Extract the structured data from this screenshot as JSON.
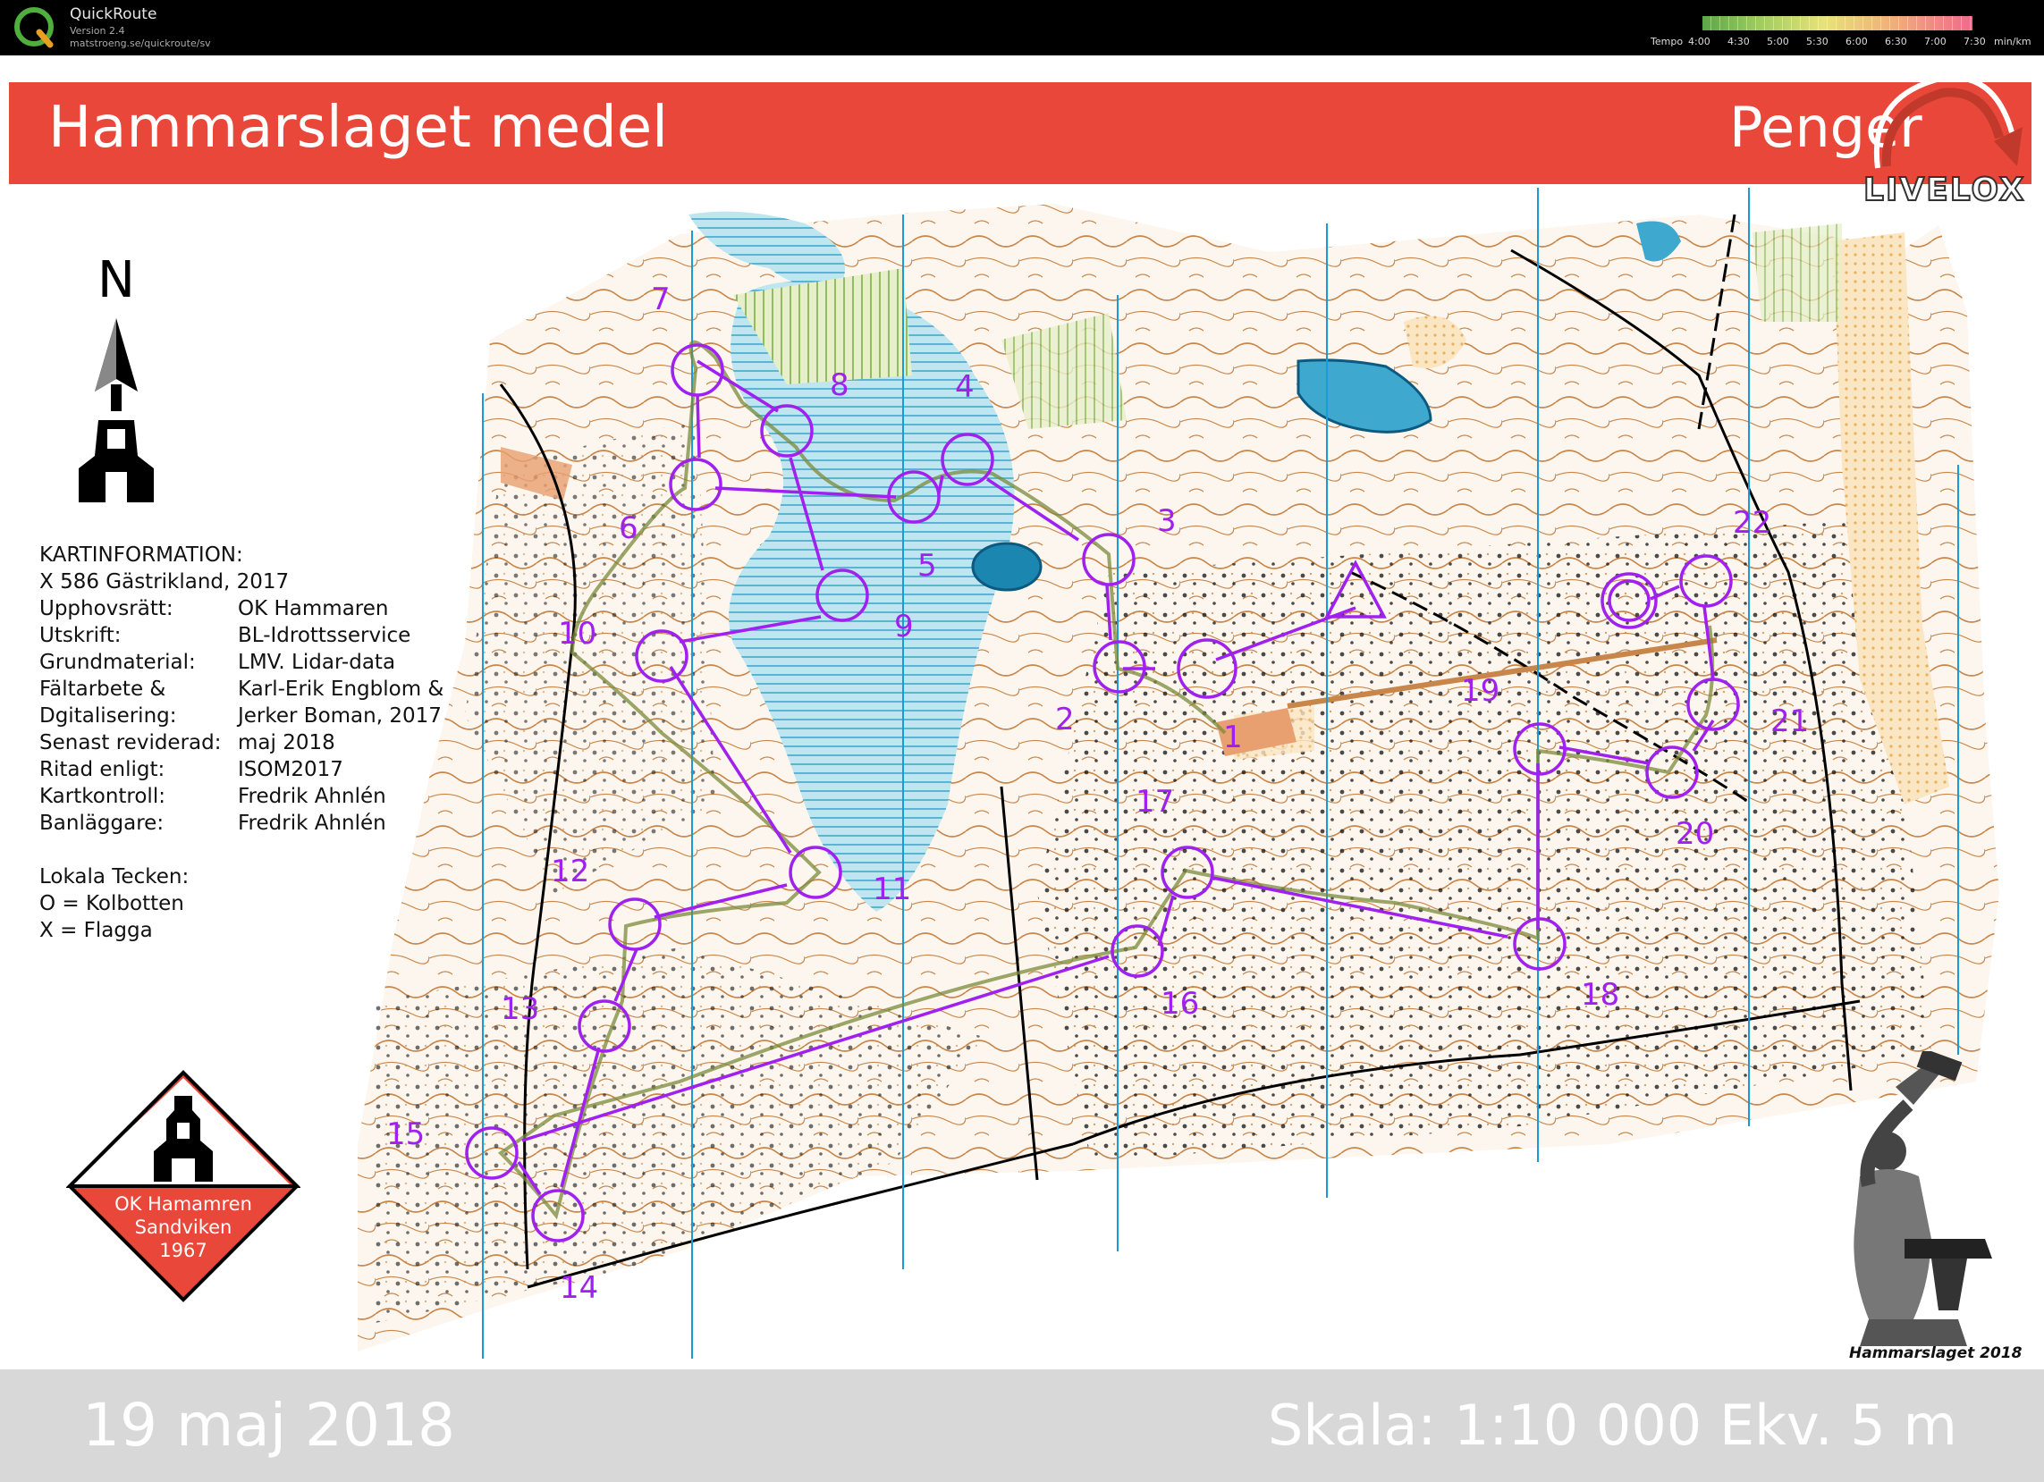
{
  "app": {
    "name": "QuickRoute",
    "version": "Version 2.4",
    "url": "matstroeng.se/quickroute/sv"
  },
  "pace_legend": {
    "label_prefix": "Tempo",
    "ticks": [
      "4:00",
      "4:30",
      "5:00",
      "5:30",
      "6:00",
      "6:30",
      "7:00",
      "7:30"
    ],
    "unit": "min/km",
    "colors": [
      "#5aa64a",
      "#8cc35a",
      "#c2db6a",
      "#e8e27a",
      "#f2c97a",
      "#f0a07a",
      "#e87a7a",
      "#f06a8a"
    ]
  },
  "map": {
    "title": "Hammarslaget medel",
    "course": "Penger",
    "date": "19 maj 2018",
    "scale": "Skala: 1:10 000 Ekv. 5 m",
    "banner_color": "#e8473a",
    "course_color": "#a020f0",
    "route_color": "#7a8a3a",
    "north_label": "N",
    "brand": "LIVELOX",
    "club_badge": [
      "OK Hamamren",
      "Sandviken",
      "1967"
    ],
    "event_caption": "Hammarslaget 2018"
  },
  "kartinformation": {
    "heading": "KARTINFORMATION:",
    "subheading": "X 586 Gästrikland, 2017",
    "rows": [
      {
        "k": "Upphovsrätt:",
        "v": "OK Hammaren"
      },
      {
        "k": "Utskrift:",
        "v": "BL-Idrottsservice"
      },
      {
        "k": "Grundmaterial:",
        "v": "LMV. Lidar-data"
      },
      {
        "k": "Fältarbete &",
        "v": "Karl-Erik Engblom &"
      },
      {
        "k": "Dgitalisering:",
        "v": "Jerker Boman, 2017"
      },
      {
        "k": "Senast reviderad:",
        "v": "maj 2018"
      },
      {
        "k": "Ritad enligt:",
        "v": "ISOM2017"
      },
      {
        "k": "Kartkontroll:",
        "v": "Fredrik Ahnlén"
      },
      {
        "k": "Banläggare:",
        "v": "Fredrik Ahnlén"
      }
    ],
    "local_heading": "Lokala Tecken:",
    "local_rows": [
      "O = Kolbotten",
      "X = Flagga"
    ]
  },
  "controls": [
    "1",
    "2",
    "3",
    "4",
    "5",
    "6",
    "7",
    "8",
    "9",
    "10",
    "11",
    "12",
    "13",
    "14",
    "15",
    "16",
    "17",
    "18",
    "19",
    "20",
    "21",
    "22"
  ]
}
